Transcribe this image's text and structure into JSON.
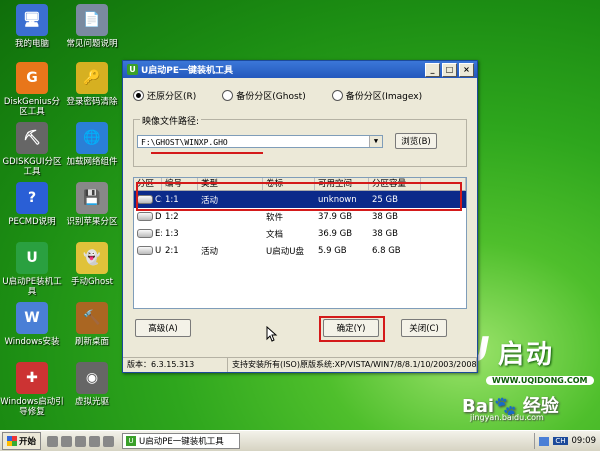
{
  "desktop": {
    "icons": [
      {
        "label": "我的电脑",
        "glyph": "🖥",
        "color": "#3b6fd1"
      },
      {
        "label": "常见问题说明",
        "glyph": "📄",
        "color": "#7a8aa0"
      },
      {
        "label": "DiskGenius分区工具",
        "glyph": "G",
        "color": "#e8761a"
      },
      {
        "label": "登录密码清除",
        "glyph": "🔑",
        "color": "#d6b021"
      },
      {
        "label": "GDISKGUI分区工具",
        "glyph": "⛏",
        "color": "#666666"
      },
      {
        "label": "加载网络组件",
        "glyph": "🌐",
        "color": "#2a7fd6"
      },
      {
        "label": "PECMD说明",
        "glyph": "?",
        "color": "#2a5fd6"
      },
      {
        "label": "识别苹果分区",
        "glyph": "💾",
        "color": "#888888"
      },
      {
        "label": "U启动PE装机工具",
        "glyph": "U",
        "color": "#2aa040"
      },
      {
        "label": "手动Ghost",
        "glyph": "👻",
        "color": "#e0c23a"
      },
      {
        "label": "Windows安装",
        "glyph": "W",
        "color": "#4a7fd6"
      },
      {
        "label": "刷新桌面",
        "glyph": "🔨",
        "color": "#aa6622"
      },
      {
        "label": "Windows启动引导修复",
        "glyph": "✚",
        "color": "#cc3333"
      },
      {
        "label": "虚拟光驱",
        "glyph": "◉",
        "color": "#666666"
      }
    ],
    "brand": {
      "u": "U",
      "name": "启动",
      "url": "WWW.UQIDONG.COM"
    },
    "watermark": {
      "main": "Bai🐾 经验",
      "sub": "jingyan.baidu.com"
    }
  },
  "window": {
    "title": "U启动PE一键装机工具",
    "title_buttons": [
      "_",
      "□",
      "×"
    ],
    "radios": [
      {
        "label": "还原分区(R)",
        "checked": true
      },
      {
        "label": "备份分区(Ghost)",
        "checked": false
      },
      {
        "label": "备份分区(Imagex)",
        "checked": false
      }
    ],
    "image_path_label": "映像文件路径:",
    "image_path_value": "F:\\GHOST\\WINXP.GHO",
    "combo_arrow": "▼",
    "browse_label": "浏览(B)",
    "table": {
      "headers": [
        "分区",
        "编号",
        "类型",
        "卷标",
        "可用空间",
        "分区容量"
      ],
      "rows": [
        {
          "part": "C:",
          "num": "1:1",
          "type": "活动",
          "label": "",
          "free": "unknown",
          "size": "25 GB",
          "selected": true
        },
        {
          "part": "D:",
          "num": "1:2",
          "type": "",
          "label": "软件",
          "free": "37.9 GB",
          "size": "38 GB",
          "selected": false
        },
        {
          "part": "E:",
          "num": "1:3",
          "type": "",
          "label": "文档",
          "free": "36.9 GB",
          "size": "38 GB",
          "selected": false
        },
        {
          "part": "U:",
          "num": "2:1",
          "type": "活动",
          "label": "U启动U盘",
          "free": "5.9 GB",
          "size": "6.8 GB",
          "selected": false
        }
      ]
    },
    "advanced_label": "高级(A)",
    "ok_label": "确定(Y)",
    "close_label": "关闭(C)",
    "status": {
      "version": "版本：6.3.15.313",
      "support": "支持安装所有(ISO)原版系统:XP/VISTA/WIN7/8/8.1/10/2003/2008/"
    }
  },
  "taskbar": {
    "start_label": "开始",
    "task_label": "U启动PE一键装机工具",
    "lang": "CH",
    "time": "09:09"
  },
  "colors": {
    "highlight_red": "#d41a1a",
    "selection": "#0b2a8a",
    "desktop_green": "#2ea61d"
  }
}
